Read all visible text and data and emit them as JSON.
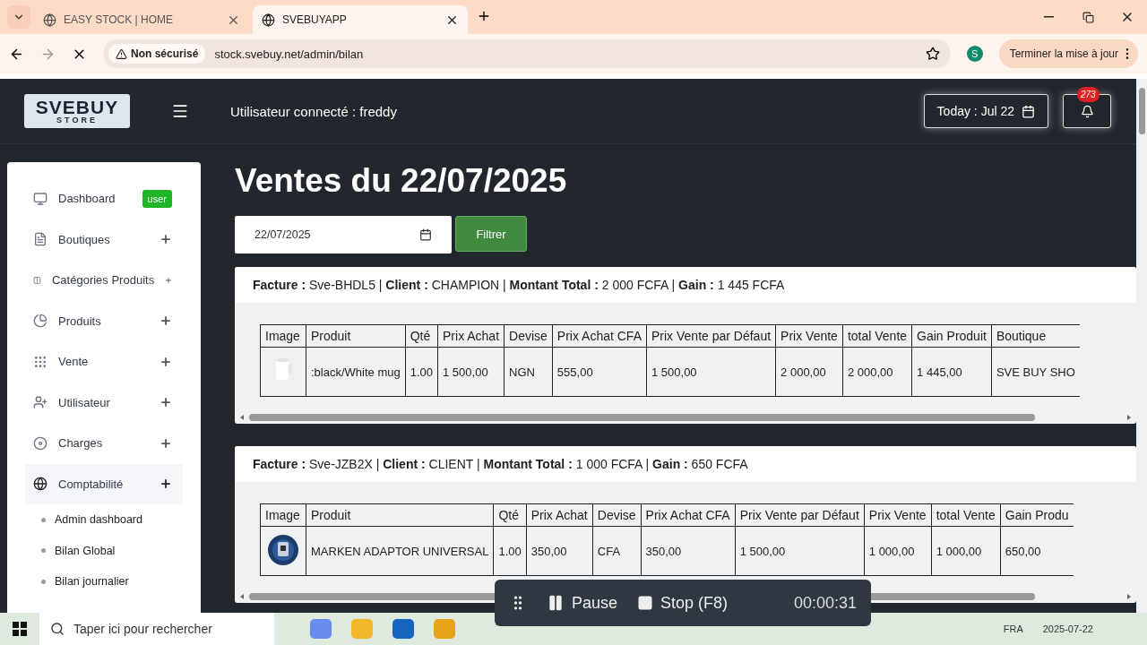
{
  "browser": {
    "tabs": [
      {
        "title": "EASY STOCK | HOME",
        "selected": false
      },
      {
        "title": "SVEBUYAPP",
        "selected": true
      }
    ],
    "address": {
      "security": "Non sécurisé",
      "url": "stock.svebuy.net/admin/bilan"
    },
    "profile": "S",
    "update_button": "Terminer la mise à jour"
  },
  "header": {
    "logo": {
      "line_1": "SVEBUY",
      "line_2": "STORE"
    },
    "user_label": "Utilisateur connecté : freddy",
    "today": "Today : Jul 22",
    "notifications": "273"
  },
  "sidebar": {
    "items": [
      {
        "label": "Dashboard",
        "badge": "user",
        "selected": false
      },
      {
        "label": "Boutiques",
        "selected": false
      },
      {
        "label": "Catégories Produits",
        "selected": false
      },
      {
        "label": "Produits",
        "selected": false
      },
      {
        "label": "Vente",
        "selected": false
      },
      {
        "label": "Utilisateur",
        "selected": false
      },
      {
        "label": "Charges",
        "selected": false
      },
      {
        "label": "Comptabilité",
        "selected": true,
        "children": [
          {
            "label": "Admin dashboard"
          },
          {
            "label": "Bilan Global"
          },
          {
            "label": "Bilan journalier"
          }
        ]
      }
    ]
  },
  "page": {
    "title": "Ventes du 22/07/2025",
    "date_filter": {
      "value": "22/07/2025"
    },
    "filter_button": "Filtrer"
  },
  "invoices": [
    {
      "summary": "**Facture :** Sve-BHDL5 | **Client :** CHAMPION | **Montant Total :** 2 000 FCFA | **Gain :** 1 445 FCFA",
      "columns": [
        "Image",
        "Produit",
        "Qté",
        "Prix Achat",
        "Devise",
        "Prix Achat CFA",
        "Prix Vente par Défaut",
        "Prix Vente",
        "total Vente",
        "Gain Produit",
        "Boutique"
      ],
      "rows": [
        {
          "cells": [
            {
              "kind": "picture"
            },
            ":black/White mug",
            "1.00",
            "1 500,00",
            "NGN",
            "555,00",
            "1 500,00",
            "2 000,00",
            "2 000,00",
            "1 445,00",
            "SVE BUY SHO"
          ]
        }
      ]
    },
    {
      "summary": "**Facture :** Sve-JZB2X | **Client :** CLIENT | **Montant Total :** 1 000 FCFA | **Gain :** 650 FCFA",
      "columns": [
        "Image",
        "Produit",
        "Qté",
        "Prix Achat",
        "Devise",
        "Prix Achat CFA",
        "Prix Vente par Défaut",
        "Prix Vente",
        "total Vente",
        "Gain Produ"
      ],
      "rows": [
        {
          "cells": [
            {
              "kind": "picture"
            },
            "MARKEN ADAPTOR UNIVERSAL",
            "1.00",
            "350,00",
            "CFA",
            "350,00",
            "1 500,00",
            "1 000,00",
            "1 000,00",
            "650,00"
          ]
        }
      ]
    }
  ],
  "recorder": {
    "pause": "Pause",
    "stop": "Stop",
    "shortcut": "(F8)",
    "timer": "00:00:31"
  },
  "taskbar": {
    "search_placeholder": "Taper ici pour rechercher",
    "language": "FRA",
    "date": "2025-07-22"
  }
}
